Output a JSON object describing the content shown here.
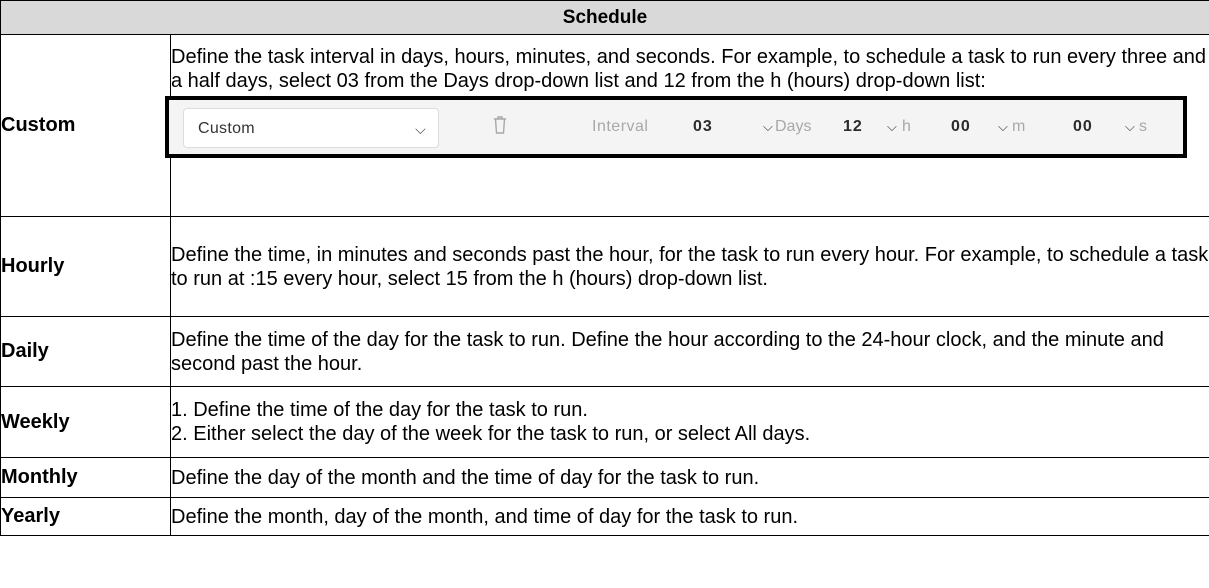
{
  "table": {
    "header": "Schedule",
    "rows": [
      {
        "label": "Custom",
        "description": "Define the task interval in days, hours, minutes, and seconds. For example, to schedule a task to run every three and a half days, select 03 from the Days drop-down list and 12 from the h (hours) drop-down list:"
      },
      {
        "label": "Hourly",
        "description": "Define the time, in minutes and seconds past the hour, for the task to run every hour. For example, to schedule a task to run at :15 every hour, select 15 from the h (hours) drop-down list."
      },
      {
        "label": "Daily",
        "description": "Define the time of the day for the task to run. Define the hour according to the 24-hour clock, and the minute and second past the hour."
      },
      {
        "label": "Weekly",
        "steps": [
          "1.  Define the time of the day for the task to run.",
          "2.  Either select the day of the week for the task to run, or select All days."
        ]
      },
      {
        "label": "Monthly",
        "description": "Define the day of the month and the time of day for the task to run."
      },
      {
        "label": "Yearly",
        "description": "Define the month, day of the month, and time of day for the task to run."
      }
    ]
  },
  "control": {
    "frequency_value": "Custom",
    "interval_label": "Interval",
    "days_value": "03",
    "days_unit": "Days",
    "hours_value": "12",
    "hours_unit": "h",
    "minutes_value": "00",
    "minutes_unit": "m",
    "seconds_value": "00",
    "seconds_unit": "s",
    "icons": {
      "delete": "trash-icon",
      "dropdown": "chevron-down-icon"
    }
  },
  "colors": {
    "header_bg": "#d9d9d9",
    "control_bg": "#f4f4f5",
    "muted_text": "#a8a8ad"
  }
}
